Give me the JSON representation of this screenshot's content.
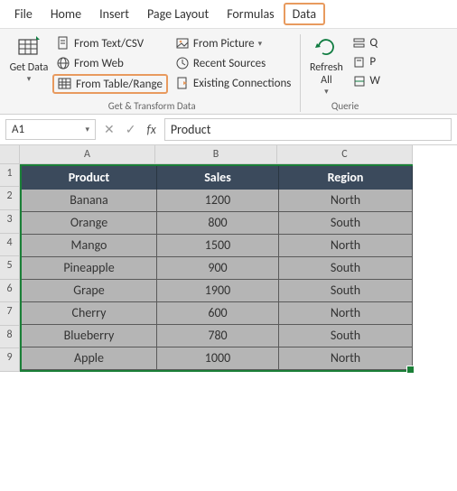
{
  "menubar": [
    "File",
    "Home",
    "Insert",
    "Page Layout",
    "Formulas",
    "Data"
  ],
  "menubar_active_index": 5,
  "ribbon": {
    "get_data": "Get Data",
    "from_text_csv": "From Text/CSV",
    "from_web": "From Web",
    "from_table_range": "From Table/Range",
    "from_picture": "From Picture",
    "recent_sources": "Recent Sources",
    "existing_connections": "Existing Connections",
    "group1_label": "Get & Transform Data",
    "refresh_all": "Refresh All",
    "q_label": "Q",
    "p_label": "P",
    "w_label": "W",
    "group2_label": "Querie"
  },
  "formula_bar": {
    "name_box": "A1",
    "value": "Product"
  },
  "columns": [
    "A",
    "B",
    "C"
  ],
  "rows": [
    "1",
    "2",
    "3",
    "4",
    "5",
    "6",
    "7",
    "8",
    "9"
  ],
  "table": {
    "headers": [
      "Product",
      "Sales",
      "Region"
    ],
    "data": [
      [
        "Banana",
        "1200",
        "North"
      ],
      [
        "Orange",
        "800",
        "South"
      ],
      [
        "Mango",
        "1500",
        "North"
      ],
      [
        "Pineapple",
        "900",
        "South"
      ],
      [
        "Grape",
        "1900",
        "South"
      ],
      [
        "Cherry",
        "600",
        "North"
      ],
      [
        "Blueberry",
        "780",
        "South"
      ],
      [
        "Apple",
        "1000",
        "North"
      ]
    ]
  },
  "chart_data": {
    "type": "table",
    "headers": [
      "Product",
      "Sales",
      "Region"
    ],
    "rows": [
      {
        "Product": "Banana",
        "Sales": 1200,
        "Region": "North"
      },
      {
        "Product": "Orange",
        "Sales": 800,
        "Region": "South"
      },
      {
        "Product": "Mango",
        "Sales": 1500,
        "Region": "North"
      },
      {
        "Product": "Pineapple",
        "Sales": 900,
        "Region": "South"
      },
      {
        "Product": "Grape",
        "Sales": 1900,
        "Region": "South"
      },
      {
        "Product": "Cherry",
        "Sales": 600,
        "Region": "North"
      },
      {
        "Product": "Blueberry",
        "Sales": 780,
        "Region": "South"
      },
      {
        "Product": "Apple",
        "Sales": 1000,
        "Region": "North"
      }
    ]
  }
}
